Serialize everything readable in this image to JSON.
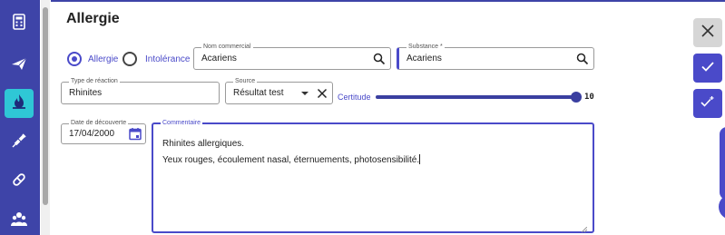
{
  "sidebar": {
    "items": [
      {
        "icon": "calculator-icon",
        "active": false
      },
      {
        "icon": "paper-plane-icon",
        "active": false
      },
      {
        "icon": "flame-icon",
        "active": true
      },
      {
        "icon": "syringe-icon",
        "active": false
      },
      {
        "icon": "pill-icon",
        "active": false
      },
      {
        "icon": "people-icon",
        "active": false
      }
    ]
  },
  "header": {
    "title": "Allergie"
  },
  "form": {
    "type_options": [
      {
        "label": "Allergie",
        "selected": true
      },
      {
        "label": "Intolérance",
        "selected": false
      }
    ],
    "nom_commercial": {
      "label": "Nom commercial",
      "value": "Acariens"
    },
    "substance": {
      "label": "Substance *",
      "value": "Acariens"
    },
    "type_reaction": {
      "label": "Type de réaction",
      "value": "Rhinites"
    },
    "source": {
      "label": "Source",
      "value": "Résultat test"
    },
    "certitude": {
      "label": "Certitude",
      "value": "10",
      "level": 1.0
    },
    "date_decouverte": {
      "label": "Date de découverte",
      "value": "17/04/2000"
    },
    "commentaire": {
      "label": "Commentaire",
      "line1": "Rhinites allergiques.",
      "line2": "Yeux rouges, écoulement nasal, éternuements, photosensibilité."
    }
  },
  "actions": [
    "close-icon",
    "check-icon",
    "check-plus-icon"
  ],
  "colors": {
    "primary": "#4a4ac9",
    "sidebar": "#3e44a8",
    "active_teal": "#2fc7d6"
  }
}
